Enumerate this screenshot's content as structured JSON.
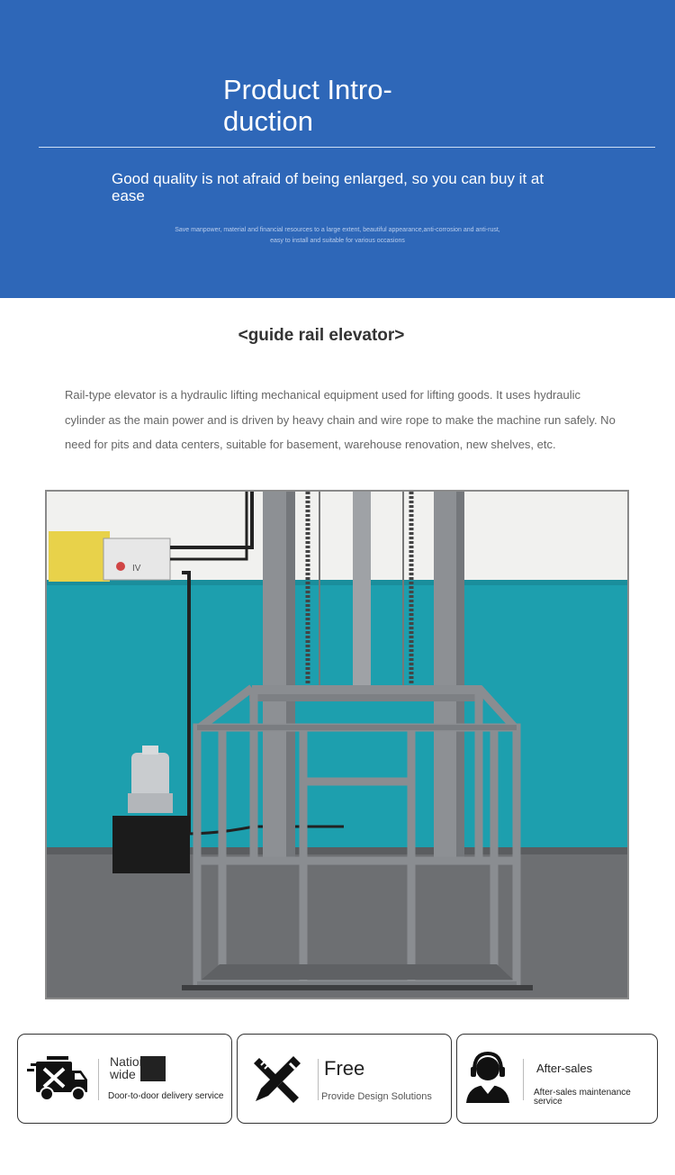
{
  "hero": {
    "title": "Product Intro- duction",
    "tagline": "Good quality is not afraid of being enlarged, so you can buy it at ease",
    "small_text": "Save manpower, material and financial resources to a large extent, beautiful appearance,anti-corrosion and anti-rust, easy to install and suitable for various occasions",
    "background_color": "#2e67b8"
  },
  "intro": {
    "title": "<guide rail elevator>",
    "body": "Rail-type elevator is a hydraulic lifting mechanical equipment used for lifting goods. It uses hydraulic cylinder as the main power and is driven by heavy chain and wire rope to make the machine run safely. No need for pits and data centers, suitable for basement, warehouse renovation, new shelves, etc."
  },
  "photo": {
    "panel_label": "IV"
  },
  "services": [
    {
      "title": "Nation-wide",
      "subtitle": "Door-to-door delivery service",
      "icon": "delivery-truck-icon"
    },
    {
      "title": "Free",
      "subtitle": "Provide Design Solutions",
      "icon": "pencil-ruler-icon"
    },
    {
      "title": "After-sales",
      "subtitle": "After-sales maintenance service",
      "icon": "headset-agent-icon"
    }
  ]
}
